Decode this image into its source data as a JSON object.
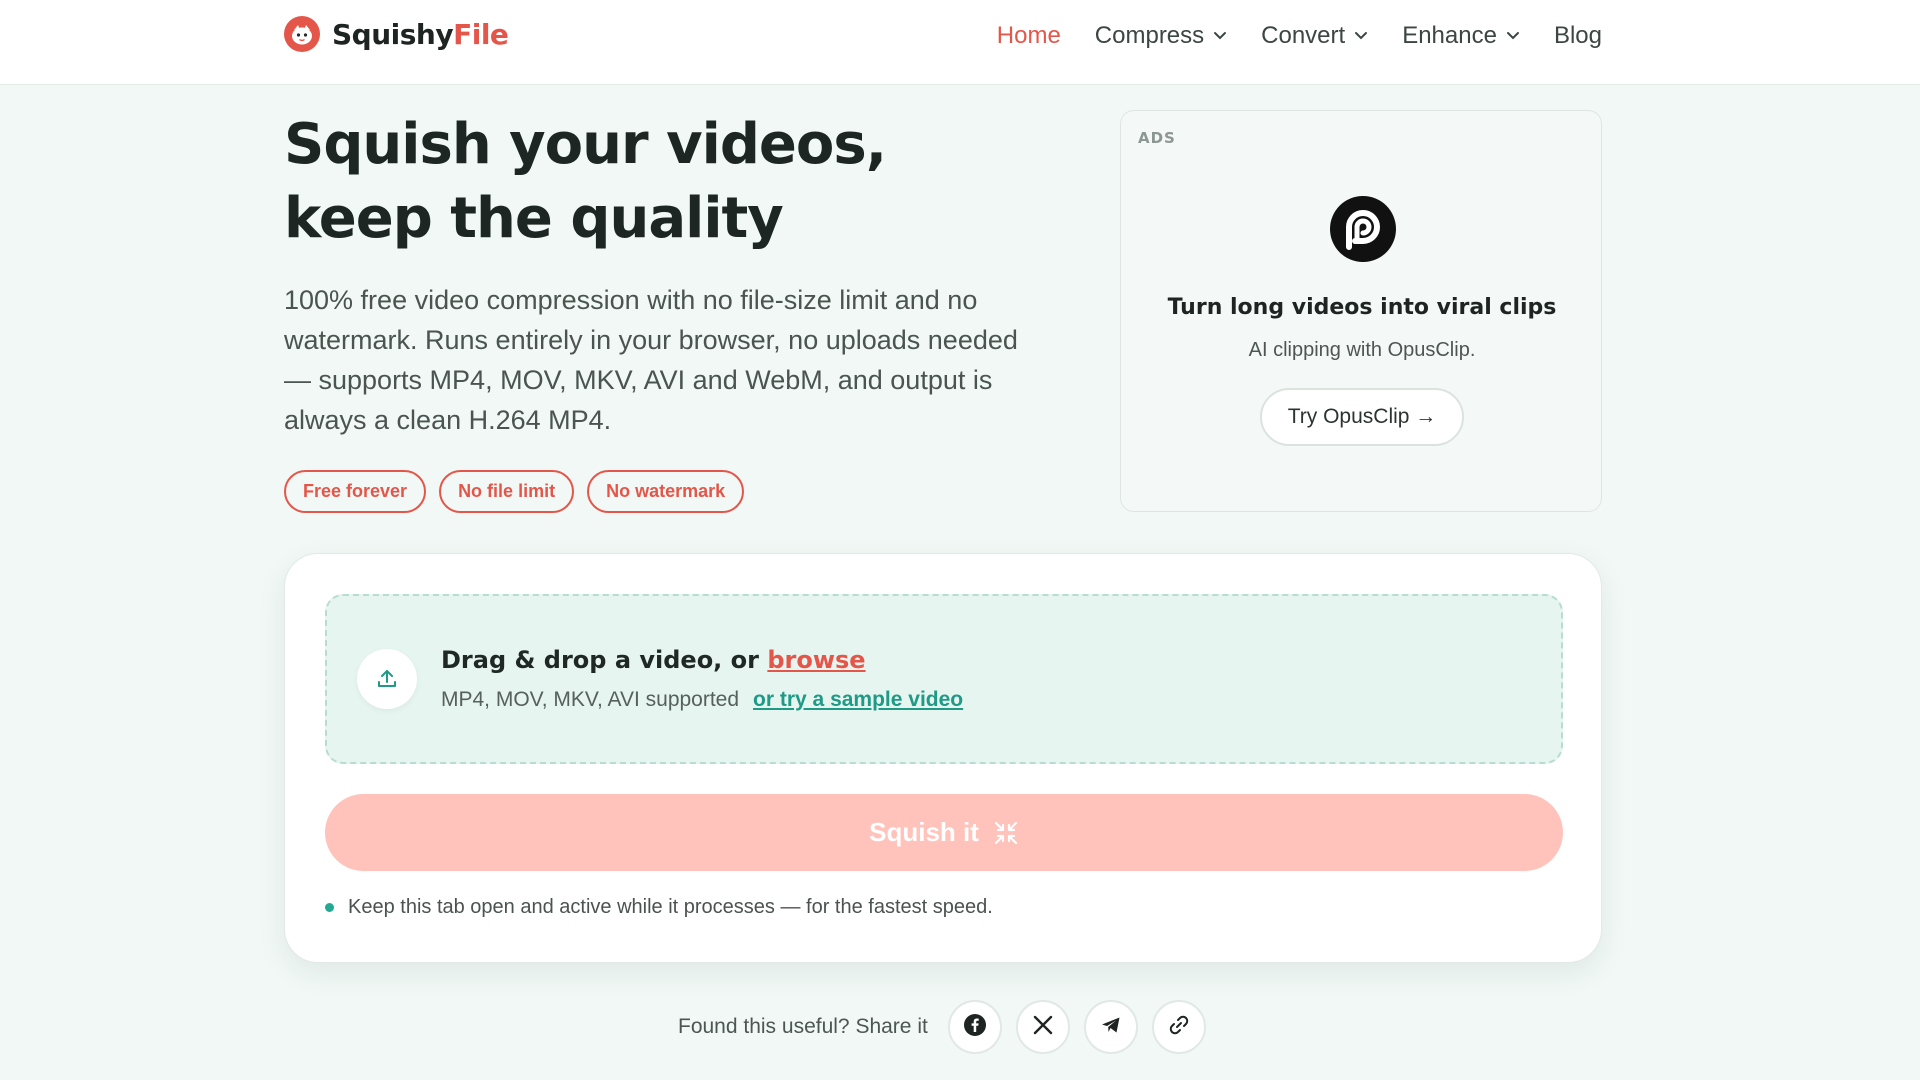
{
  "brand": {
    "name_part1": "Squishy",
    "name_part2": "File",
    "accent_color": "#e5564a",
    "logo_icon": "squishy-mascot-icon"
  },
  "nav": {
    "items": [
      {
        "label": "Home",
        "active": true,
        "dropdown": false
      },
      {
        "label": "Compress",
        "active": false,
        "dropdown": true
      },
      {
        "label": "Convert",
        "active": false,
        "dropdown": true
      },
      {
        "label": "Enhance",
        "active": false,
        "dropdown": true
      },
      {
        "label": "Blog",
        "active": false,
        "dropdown": false
      }
    ]
  },
  "hero": {
    "title_line1": "Squish your videos,",
    "title_line2": "keep the quality",
    "description": "100% free video compression with no file-size limit and no watermark. Runs entirely in your browser, no uploads needed — supports MP4, MOV, MKV, AVI and WebM, and output is always a clean H.264 MP4.",
    "chips": [
      "Free forever",
      "No file limit",
      "No watermark"
    ]
  },
  "ad": {
    "tag": "ADS",
    "logo_icon": "opusclip-logo-icon",
    "title": "Turn long videos into viral clips",
    "subtitle": "AI clipping with OpusClip.",
    "button_label": "Try OpusClip →"
  },
  "uploader": {
    "drop_text": "Drag & drop a video, or",
    "browse_label": "browse",
    "formats_text": "MP4, MOV, MKV, AVI supported",
    "sample_label": "or try a sample video",
    "upload_icon": "upload-icon",
    "squish_button_label": "Squish it",
    "squish_button_color": "#ffc3bb",
    "tip_text": "Keep this tab open and active while it processes — for the fastest speed."
  },
  "share": {
    "label": "Found this useful? Share it",
    "buttons": [
      "facebook-icon",
      "x-icon",
      "telegram-icon",
      "link-icon"
    ]
  }
}
